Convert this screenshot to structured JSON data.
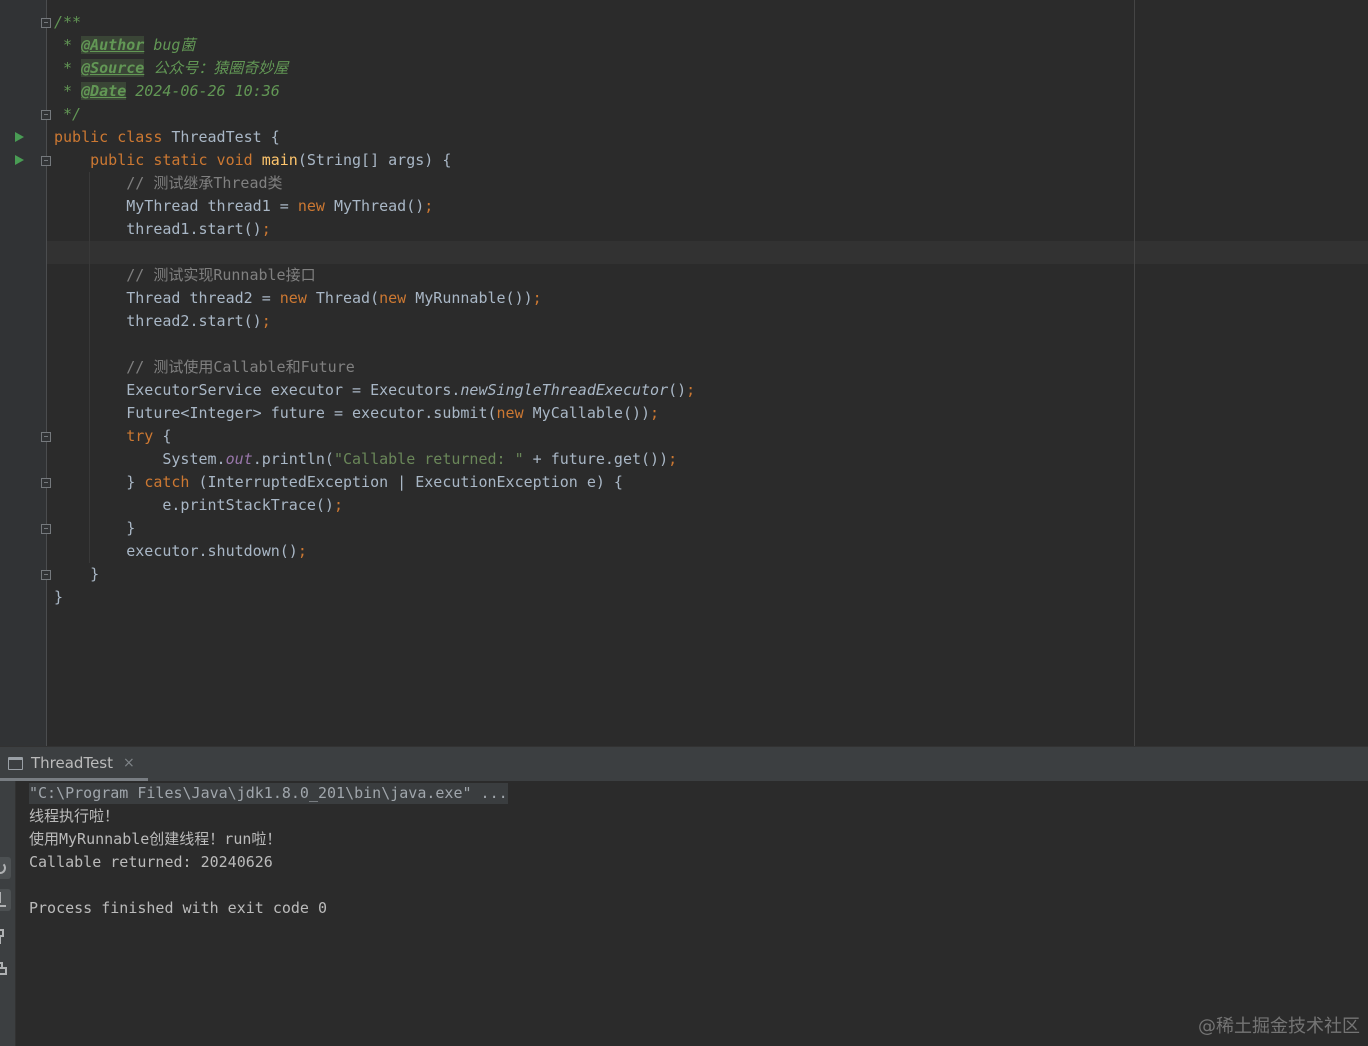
{
  "theme": {
    "background": "#2B2B2B",
    "gutter": "#313335",
    "gutter-border": "#4B4D4F",
    "current-line": "#323232",
    "right-margin": "#454545",
    "indent-guide": "#393939",
    "fold": "#75797D",
    "run": "#499C54",
    "text": "#A9B7C6",
    "keyword": "#CC7832",
    "method": "#FFC66D",
    "comment": "#808080",
    "string": "#6A8759",
    "field": "#9876AA",
    "doc": "#629755",
    "doc-tag-bg": "#3A4536",
    "panel": "#3C3F41",
    "panel-border": "#323232",
    "tab-text": "#BBBBBB",
    "tab-underline": "#787D82",
    "console-text": "#BBBBBB",
    "command-bg": "#3A3D3F",
    "command-text": "#A0A6AC"
  },
  "editor": {
    "lines": [
      {
        "fold": "start",
        "tokens": [
          {
            "x": "/**",
            "t": "doc"
          }
        ]
      },
      {
        "tokens": [
          {
            "x": " * ",
            "t": "doc"
          },
          {
            "x": "@Author",
            "t": "doctag"
          },
          {
            "x": " bug菌",
            "t": "docval"
          }
        ]
      },
      {
        "tokens": [
          {
            "x": " * ",
            "t": "doc"
          },
          {
            "x": "@Source",
            "t": "doctag"
          },
          {
            "x": " 公众号：猿圈奇妙屋",
            "t": "docval"
          }
        ]
      },
      {
        "tokens": [
          {
            "x": " * ",
            "t": "doc"
          },
          {
            "x": "@Date",
            "t": "doctag"
          },
          {
            "x": " 2024-06-26 10:36",
            "t": "docval"
          }
        ]
      },
      {
        "fold": "end",
        "tokens": [
          {
            "x": " */",
            "t": "doc"
          }
        ]
      },
      {
        "run": true,
        "tokens": [
          {
            "x": "public class",
            "t": "kw"
          },
          {
            "x": " ThreadTest {",
            "t": "text"
          }
        ]
      },
      {
        "run": true,
        "fold": "start",
        "tokens": [
          {
            "x": "    public static void",
            "t": "kw"
          },
          {
            "x": " ",
            "t": "text"
          },
          {
            "x": "main",
            "t": "method"
          },
          {
            "x": "(String[] args) {",
            "t": "text"
          }
        ]
      },
      {
        "tokens": [
          {
            "x": "        // 测试继承Thread类",
            "t": "comment"
          }
        ]
      },
      {
        "tokens": [
          {
            "x": "        MyThread thread1 = ",
            "t": "text"
          },
          {
            "x": "new",
            "t": "kw"
          },
          {
            "x": " MyThread()",
            "t": "text"
          },
          {
            "x": ";",
            "t": "semi"
          }
        ]
      },
      {
        "tokens": [
          {
            "x": "        thread1.start()",
            "t": "text"
          },
          {
            "x": ";",
            "t": "semi"
          }
        ]
      },
      {
        "current": true,
        "tokens": []
      },
      {
        "tokens": [
          {
            "x": "        // 测试实现Runnable接口",
            "t": "comment"
          }
        ]
      },
      {
        "tokens": [
          {
            "x": "        Thread thread2 = ",
            "t": "text"
          },
          {
            "x": "new",
            "t": "kw"
          },
          {
            "x": " Thread(",
            "t": "text"
          },
          {
            "x": "new",
            "t": "kw"
          },
          {
            "x": " MyRunnable())",
            "t": "text"
          },
          {
            "x": ";",
            "t": "semi"
          }
        ]
      },
      {
        "tokens": [
          {
            "x": "        thread2.start()",
            "t": "text"
          },
          {
            "x": ";",
            "t": "semi"
          }
        ]
      },
      {
        "tokens": []
      },
      {
        "tokens": [
          {
            "x": "        // 测试使用Callable和Future",
            "t": "comment"
          }
        ]
      },
      {
        "tokens": [
          {
            "x": "        ExecutorService executor = Executors.",
            "t": "text"
          },
          {
            "x": "newSingleThreadExecutor",
            "t": "smethod"
          },
          {
            "x": "()",
            "t": "text"
          },
          {
            "x": ";",
            "t": "semi"
          }
        ]
      },
      {
        "tokens": [
          {
            "x": "        Future<Integer> future = executor.submit(",
            "t": "text"
          },
          {
            "x": "new",
            "t": "kw"
          },
          {
            "x": " MyCallable())",
            "t": "text"
          },
          {
            "x": ";",
            "t": "semi"
          }
        ]
      },
      {
        "fold": "start",
        "tokens": [
          {
            "x": "        try",
            "t": "kw"
          },
          {
            "x": " {",
            "t": "text"
          }
        ]
      },
      {
        "tokens": [
          {
            "x": "            System.",
            "t": "text"
          },
          {
            "x": "out",
            "t": "field"
          },
          {
            "x": ".println(",
            "t": "text"
          },
          {
            "x": "\"Callable returned: \"",
            "t": "string"
          },
          {
            "x": " + future.get())",
            "t": "text"
          },
          {
            "x": ";",
            "t": "semi"
          }
        ]
      },
      {
        "fold": "mid",
        "tokens": [
          {
            "x": "        } ",
            "t": "text"
          },
          {
            "x": "catch",
            "t": "kw"
          },
          {
            "x": " (InterruptedException | ExecutionException e) {",
            "t": "text"
          }
        ]
      },
      {
        "tokens": [
          {
            "x": "            e.printStackTrace()",
            "t": "text"
          },
          {
            "x": ";",
            "t": "semi"
          }
        ]
      },
      {
        "fold": "end",
        "tokens": [
          {
            "x": "        }",
            "t": "text"
          }
        ]
      },
      {
        "tokens": [
          {
            "x": "        executor.shutdown()",
            "t": "text"
          },
          {
            "x": ";",
            "t": "semi"
          }
        ]
      },
      {
        "fold": "end",
        "tokens": [
          {
            "x": "    }",
            "t": "text"
          }
        ]
      },
      {
        "tokens": [
          {
            "x": "}",
            "t": "text"
          }
        ]
      }
    ]
  },
  "run_panel": {
    "tab": {
      "label": "ThreadTest",
      "close_glyph": "×",
      "icon": "console-icon"
    },
    "toolbar": [
      "rerun-icon",
      "scroll-to-end-icon",
      "pin-tab-icon",
      "print-icon"
    ],
    "console": {
      "command": "\"C:\\Program Files\\Java\\jdk1.8.0_201\\bin\\java.exe\" ...",
      "output": [
        "线程执行啦！",
        "使用MyRunnable创建线程！run啦！",
        "Callable returned: 20240626",
        "",
        "Process finished with exit code 0"
      ]
    }
  },
  "watermark": "@稀土掘金技术社区"
}
